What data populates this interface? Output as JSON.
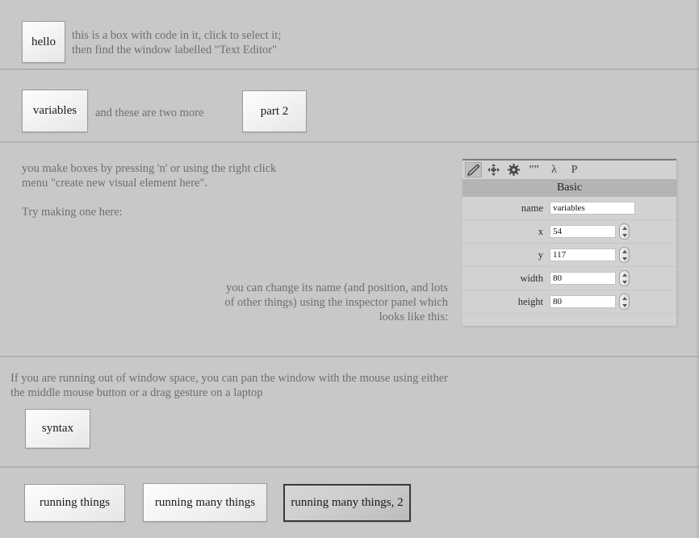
{
  "app": {
    "background_color": "#c8c8c8",
    "divider_color": "#b0b0b0"
  },
  "sections": [
    {
      "id": "intro",
      "boxes": [
        {
          "label": "hello",
          "selected": false
        }
      ],
      "text": "this is a box with code in it, click to select it;\nthen find the window labelled \"Text Editor\""
    },
    {
      "id": "variables",
      "boxes": [
        {
          "label": "variables",
          "selected": false
        },
        {
          "label": "part 2",
          "selected": false
        }
      ],
      "text": "and these are two more"
    },
    {
      "id": "making-boxes",
      "text_top": "you make boxes by pressing 'n' or using the right click\nmenu \"create new visual element here\".",
      "text_try": "Try making one here:",
      "text_inspector": "you can change its name (and position, and lots\nof other things) using the inspector panel which\nlooks like this:"
    },
    {
      "id": "panning",
      "text": "If you are running out of window space, you can pan the window with the mouse using either\nthe middle mouse button or a drag gesture on a laptop",
      "boxes": [
        {
          "label": "syntax",
          "selected": false
        }
      ]
    },
    {
      "id": "running",
      "boxes": [
        {
          "label": "running things",
          "selected": false
        },
        {
          "label": "running many things",
          "selected": false
        },
        {
          "label": "running many things, 2",
          "selected": true
        }
      ]
    }
  ],
  "inspector": {
    "toolbar": [
      {
        "icon": "pencil-icon",
        "label": "",
        "active": true
      },
      {
        "icon": "move-arrows-icon",
        "label": "",
        "active": false
      },
      {
        "icon": "gear-icon",
        "label": "",
        "active": false
      },
      {
        "icon": "quote-marks-icon",
        "label": "””",
        "active": false
      },
      {
        "icon": "lambda-icon",
        "label": "λ",
        "active": false
      },
      {
        "icon": "p-letter-icon",
        "label": "P",
        "active": false
      }
    ],
    "section_title": "Basic",
    "fields": [
      {
        "label": "name",
        "value": "variables",
        "spinner": false
      },
      {
        "label": "x",
        "value": "54",
        "spinner": true
      },
      {
        "label": "y",
        "value": "117",
        "spinner": true
      },
      {
        "label": "width",
        "value": "80",
        "spinner": true
      },
      {
        "label": "height",
        "value": "80",
        "spinner": true
      }
    ]
  }
}
